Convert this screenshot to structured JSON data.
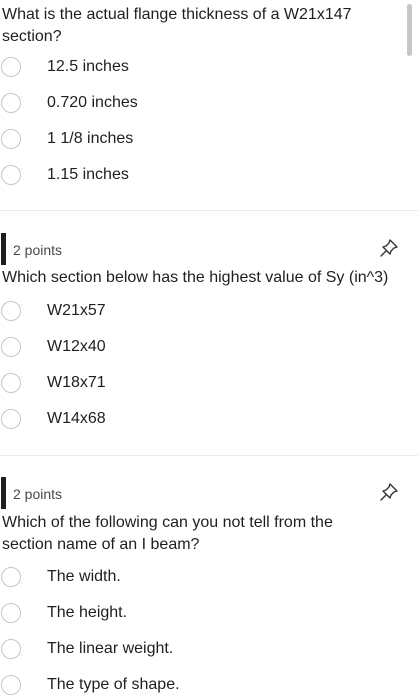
{
  "questions": [
    {
      "text": "What is the actual flange thickness of a W21x147 section?",
      "options": [
        "12.5 inches",
        "0.720 inches",
        "1 1/8 inches",
        "1.15 inches"
      ]
    },
    {
      "points": "2 points",
      "text": "Which section below has the highest value of Sy (in^3)",
      "options": [
        "W21x57",
        "W12x40",
        "W18x71",
        "W14x68"
      ],
      "pin_icon": "pin-icon"
    },
    {
      "points": "2 points",
      "text": "Which of the following can you not tell from the section name of an I beam?",
      "options": [
        "The width.",
        "The height.",
        "The linear weight.",
        "The type of shape."
      ],
      "pin_icon": "pin-icon"
    }
  ]
}
